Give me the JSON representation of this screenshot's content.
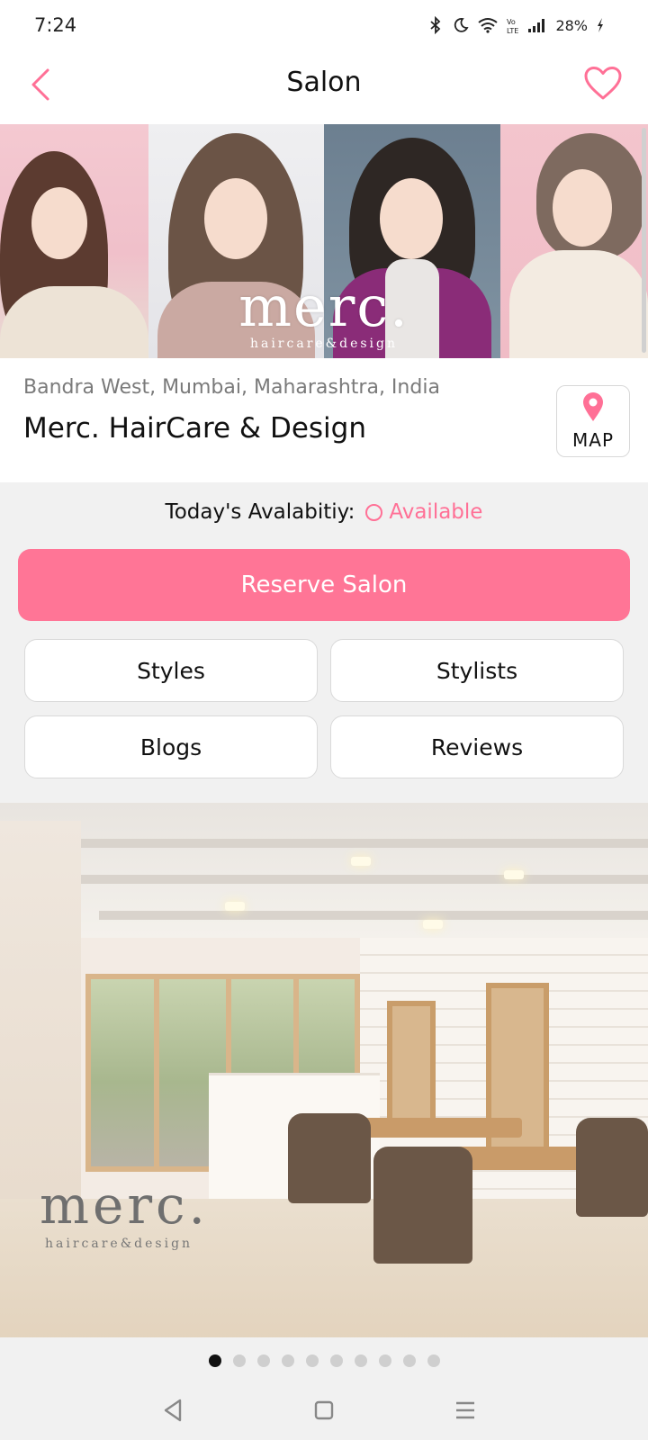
{
  "status_bar": {
    "time": "7:24",
    "battery": "28%",
    "icons": [
      "bluetooth-icon",
      "moon-icon",
      "wifi-icon",
      "volte-icon",
      "signal-icon",
      "battery-charging-icon"
    ]
  },
  "header": {
    "title": "Salon",
    "back_icon": "chevron-left-icon",
    "favorite_icon": "heart-outline-icon",
    "accent_color": "#ff7096"
  },
  "hero": {
    "logo": "merc.",
    "tagline": "haircare&design"
  },
  "salon": {
    "location": "Bandra West, Mumbai, Maharashtra, India",
    "name": "Merc. HairCare & Design",
    "map_label": "MAP",
    "map_icon": "map-pin-icon"
  },
  "availability": {
    "label": "Today's Avalabitiy:",
    "status": "Available",
    "status_color": "#ff7096"
  },
  "actions": {
    "reserve_label": "Reserve Salon",
    "reserve_color": "#ff7596",
    "buttons": [
      {
        "label": "Styles"
      },
      {
        "label": "Stylists"
      },
      {
        "label": "Blogs"
      },
      {
        "label": "Reviews"
      }
    ]
  },
  "interior": {
    "logo": "merc.",
    "tagline": "haircare&design"
  },
  "pagination": {
    "total": 10,
    "active": 1
  },
  "nav_bar": {
    "icons": [
      "back-triangle-icon",
      "home-square-icon",
      "menu-lines-icon"
    ]
  }
}
